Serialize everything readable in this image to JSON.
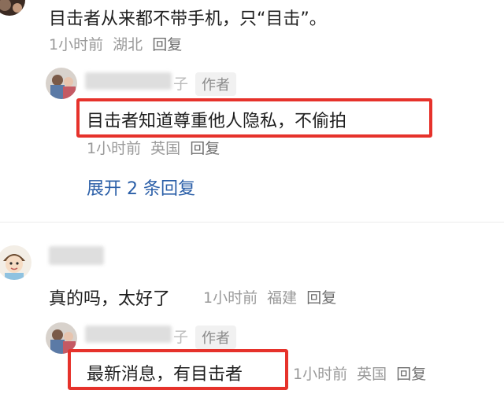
{
  "comment1": {
    "text": "目击者从来都不带手机，只“目击”。",
    "time": "1小时前",
    "location": "湖北",
    "reply": "回复",
    "sub_reply": {
      "name_suffix": "子",
      "badge": "作者",
      "text": "目击者知道尊重他人隐私，不偷拍",
      "time": "1小时前",
      "location": "英国",
      "reply": "回复"
    },
    "expand": "展开 2 条回复"
  },
  "comment2": {
    "text": "真的吗，太好了",
    "time": "1小时前",
    "location": "福建",
    "reply": "回复",
    "sub_reply": {
      "name_suffix": "子",
      "badge": "作者",
      "text": "最新消息，有目击者",
      "time": "1小时前",
      "location": "英国",
      "reply": "回复"
    }
  },
  "colors": {
    "highlight": "#e6322b",
    "link": "#2b5fa8",
    "meta": "#9a9a9a"
  }
}
